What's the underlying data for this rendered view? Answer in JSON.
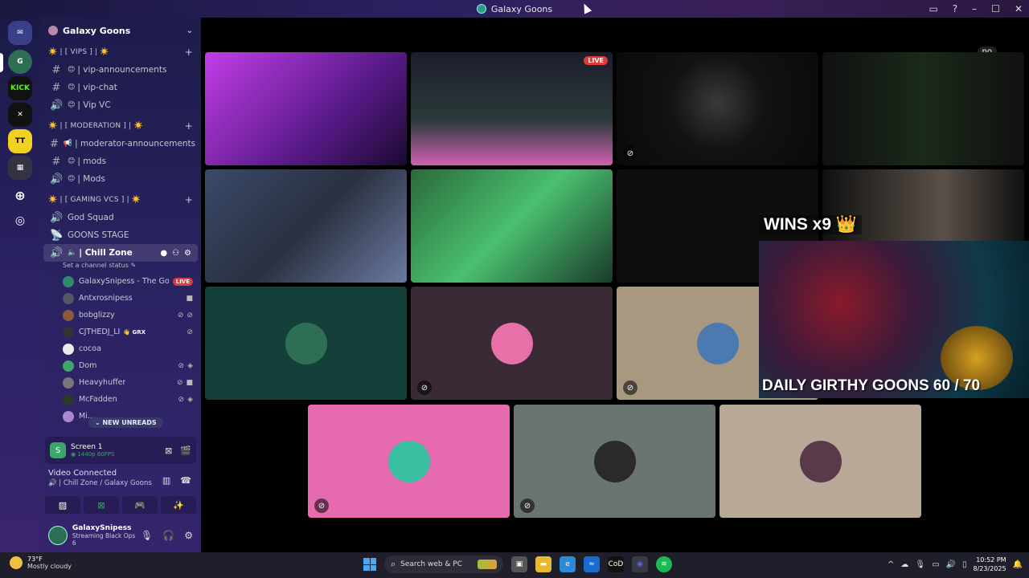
{
  "window": {
    "title": "Galaxy Goons"
  },
  "server": {
    "name": "Galaxy Goons",
    "categories": [
      {
        "label": "☀️ | [ VIPS ] | ☀️",
        "channels": [
          {
            "type": "text",
            "label": "| vip-announcements",
            "emoji": "😊"
          },
          {
            "type": "text",
            "label": "| vip-chat",
            "emoji": "😊"
          },
          {
            "type": "voice",
            "label": "| Vip VC",
            "emoji": "😊"
          }
        ]
      },
      {
        "label": "☀️ | [ MODERATION ] | ☀️",
        "channels": [
          {
            "type": "text",
            "label": "| moderator-announcements",
            "emoji": "📢"
          },
          {
            "type": "text",
            "label": "| mods",
            "emoji": "😊"
          },
          {
            "type": "voice",
            "label": "| Mods",
            "emoji": "😊"
          }
        ]
      },
      {
        "label": "☀️ | [ GAMING VCS ] | ☀️",
        "channels": [
          {
            "type": "voice",
            "label": "God Squad"
          },
          {
            "type": "voice",
            "label": "GOONS STAGE"
          },
          {
            "type": "voice",
            "label": "| Chill Zone",
            "active": true
          }
        ]
      }
    ],
    "set_status": "Set a channel status",
    "members": [
      {
        "name": "GalaxySnipess - The Go...",
        "badge": "LIVE",
        "color": "#2e8b6b"
      },
      {
        "name": "Antxrosnipess",
        "color": "#556"
      },
      {
        "name": "bobglizzy",
        "color": "#8a5a3a"
      },
      {
        "name": "CJTHEDJ_LI",
        "tag": "👋 GRX",
        "color": "#333"
      },
      {
        "name": "cocoa",
        "color": "#eaeaea"
      },
      {
        "name": "Dom",
        "color": "#3ba56b"
      },
      {
        "name": "Heavyhuffer",
        "color": "#777"
      },
      {
        "name": "McFadden",
        "color": "#2a3a2a"
      },
      {
        "name": "Mi...",
        "color": "#aa88cc"
      }
    ],
    "new_unreads": "⌄ NEW UNREADS"
  },
  "screen_share": {
    "title": "Screen 1",
    "quality": "◉ 1440p 60FPS"
  },
  "voice": {
    "status": "Video Connected",
    "location": "| Chill Zone / Galaxy Goons"
  },
  "user": {
    "name": "GalaxySnipess",
    "status": "Streaming Black Ops 6"
  },
  "stage": {
    "live_label": "LIVE",
    "no_label": "no",
    "overlay_wins": "WINS x9 👑",
    "overlay_daily": "DAILY GIRTHY GOONS  60 / 70"
  },
  "taskbar": {
    "temperature": "73°F",
    "weather": "Mostly cloudy",
    "search_placeholder": "Search web & PC",
    "time": "10:52 PM",
    "date": "8/23/2025"
  },
  "colors": {
    "accent": "#5865f2",
    "live": "#e03a3a",
    "online": "#3ba56b"
  }
}
